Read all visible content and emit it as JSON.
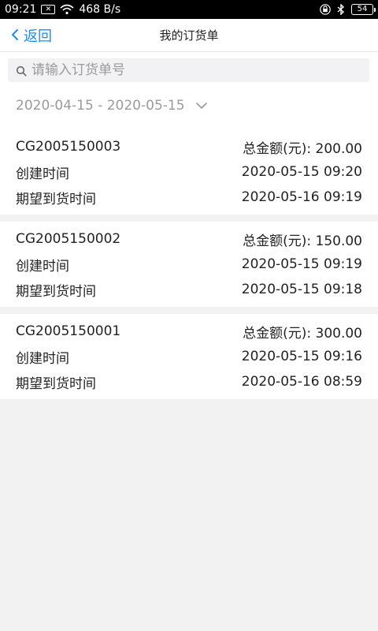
{
  "statusbar": {
    "time": "09:21",
    "speed": "468 B/s",
    "battery": "54"
  },
  "navbar": {
    "back_label": "返回",
    "title": "我的订货单"
  },
  "search": {
    "placeholder": "请输入订货单号"
  },
  "date_range": "2020-04-15 - 2020-05-15",
  "orders": [
    {
      "order_no": "CG2005150003",
      "total_label": "总金额(元):",
      "total_value": "200.00",
      "created_label": "创建时间",
      "created_value": "2020-05-15 09:20",
      "expected_label": "期望到货时间",
      "expected_value": "2020-05-16 09:19"
    },
    {
      "order_no": "CG2005150002",
      "total_label": "总金额(元):",
      "total_value": "150.00",
      "created_label": "创建时间",
      "created_value": "2020-05-15 09:19",
      "expected_label": "期望到货时间",
      "expected_value": "2020-05-15 09:18"
    },
    {
      "order_no": "CG2005150001",
      "total_label": "总金额(元):",
      "total_value": "300.00",
      "created_label": "创建时间",
      "created_value": "2020-05-15 09:16",
      "expected_label": "期望到货时间",
      "expected_value": "2020-05-16 08:59"
    }
  ]
}
